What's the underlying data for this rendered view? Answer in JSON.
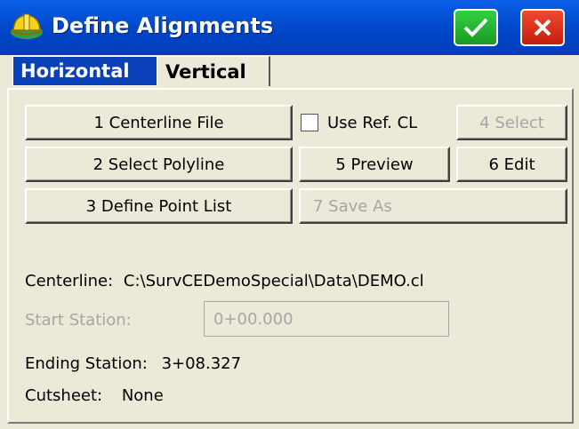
{
  "window": {
    "title": "Define Alignments",
    "colors": {
      "titlebar": "#0046c8",
      "ok": "#1a9a24",
      "close": "#c41d0c",
      "active_tab": "#0a40b8"
    }
  },
  "tabs": [
    {
      "label": "Horizontal",
      "active": true
    },
    {
      "label": "Vertical",
      "active": false
    }
  ],
  "buttons": {
    "centerline_file": "1 Centerline File",
    "use_ref_cl": "Use Ref. CL",
    "select": "4 Select",
    "select_polyline": "2 Select Polyline",
    "preview": "5 Preview",
    "edit": "6 Edit",
    "define_point_list": "3 Define Point List",
    "save_as": "7 Save As"
  },
  "info": {
    "centerline_label": "Centerline:",
    "centerline_value": "C:\\SurvCEDemoSpecial\\Data\\DEMO.cl",
    "start_station_label": "Start Station:",
    "start_station_value": "0+00.000",
    "ending_station_label": "Ending Station:",
    "ending_station_value": "3+08.327",
    "cutsheet_label": "Cutsheet:",
    "cutsheet_value": "None"
  }
}
